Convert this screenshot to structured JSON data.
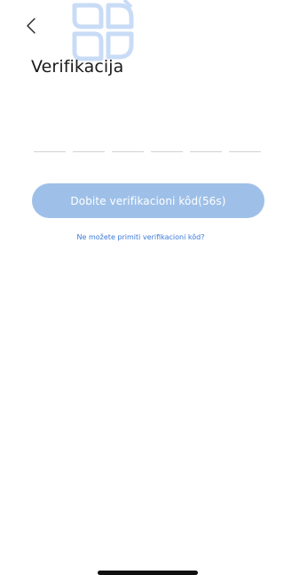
{
  "screen": {
    "title": "Verifikacija",
    "code_length": 6,
    "get_code_button": "Dobite verifikacioni kôd(56s)",
    "help_link": "Ne možete primiti verifikacioni kôd?"
  },
  "icons": {
    "back": "chevron-left-icon",
    "watermark": "brand-logo-watermark"
  },
  "colors": {
    "button_disabled": "#9ec0e8",
    "link": "#3b78d8",
    "title": "#1a1a1a",
    "input_underline": "#d2d2d2",
    "watermark": "#c9dcf6"
  }
}
